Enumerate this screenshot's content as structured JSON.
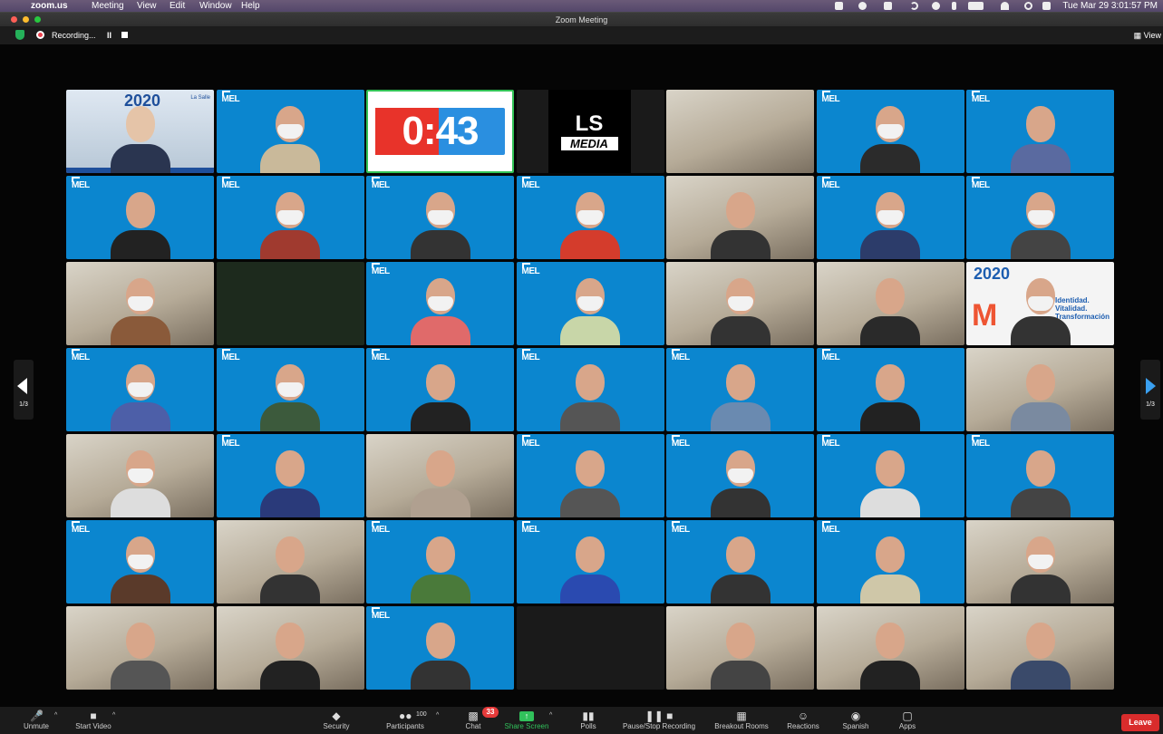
{
  "menubar": {
    "apple": "",
    "app": "zoom.us",
    "items": [
      "Meeting",
      "View",
      "Edit",
      "Window",
      "Help"
    ],
    "clock": "Tue Mar 29  3:01:57 PM",
    "tray_icons": [
      "camera-icon",
      "grammarly-icon",
      "app-icon",
      "moon-icon",
      "play-icon",
      "bluetooth-icon",
      "battery-icon",
      "wifi-icon",
      "search-icon",
      "control-center-icon"
    ]
  },
  "window": {
    "title": "Zoom Meeting"
  },
  "recording": {
    "label": "Recording...",
    "pause": "II",
    "view": "View"
  },
  "tiles": [
    {
      "kind": "first"
    },
    {
      "kind": "blue-person",
      "mask": true,
      "shirt": "#c9b99a"
    },
    {
      "kind": "timer",
      "text": "0:43"
    },
    {
      "kind": "lsmedia",
      "top": "LS",
      "bottom": "MEDIA"
    },
    {
      "kind": "room"
    },
    {
      "kind": "blue-person",
      "mask": true,
      "shirt": "#2b2b2b"
    },
    {
      "kind": "blue-person",
      "mask": false,
      "shirt": "#5a6aa0"
    },
    {
      "kind": "blue-person",
      "mask": false,
      "shirt": "#222"
    },
    {
      "kind": "blue-person",
      "mask": true,
      "shirt": "#a03a2f"
    },
    {
      "kind": "blue-person",
      "mask": true,
      "shirt": "#333"
    },
    {
      "kind": "blue-person",
      "mask": true,
      "shirt": "#d43c2c"
    },
    {
      "kind": "room-person",
      "mask": false,
      "shirt": "#333"
    },
    {
      "kind": "blue-person",
      "mask": true,
      "shirt": "#2c3c6a"
    },
    {
      "kind": "blue-person",
      "mask": true,
      "shirt": "#444"
    },
    {
      "kind": "room-person",
      "mask": true,
      "shirt": "#8a5a3a"
    },
    {
      "kind": "dark"
    },
    {
      "kind": "blue-person",
      "mask": true,
      "shirt": "#e06a6a"
    },
    {
      "kind": "blue-person",
      "mask": true,
      "shirt": "#c8d6a8"
    },
    {
      "kind": "room-person",
      "mask": true,
      "shirt": "#333"
    },
    {
      "kind": "room-person",
      "mask": false,
      "shirt": "#2a2a2a"
    },
    {
      "kind": "brand",
      "line1": "Identidad.",
      "line2": "Vitalidad.",
      "line3": "Transformación"
    },
    {
      "kind": "blue-person",
      "mask": true,
      "shirt": "#4d5fa8"
    },
    {
      "kind": "blue-person",
      "mask": true,
      "shirt": "#3c5a3c"
    },
    {
      "kind": "blue-person",
      "mask": false,
      "shirt": "#222"
    },
    {
      "kind": "blue-person",
      "mask": false,
      "shirt": "#555"
    },
    {
      "kind": "blue-person",
      "mask": false,
      "shirt": "#6a8ab0"
    },
    {
      "kind": "blue-person",
      "mask": false,
      "shirt": "#222"
    },
    {
      "kind": "room-person",
      "mask": false,
      "shirt": "#7a8aa0"
    },
    {
      "kind": "room-person",
      "mask": true,
      "shirt": "#ddd"
    },
    {
      "kind": "blue-person",
      "mask": false,
      "shirt": "#2a3a7a"
    },
    {
      "kind": "room-person",
      "mask": false,
      "shirt": "#b0a090"
    },
    {
      "kind": "blue-person",
      "mask": false,
      "shirt": "#555"
    },
    {
      "kind": "blue-person",
      "mask": true,
      "shirt": "#333"
    },
    {
      "kind": "blue-person",
      "mask": false,
      "shirt": "#ddd"
    },
    {
      "kind": "blue-person",
      "mask": false,
      "shirt": "#444"
    },
    {
      "kind": "blue-person",
      "mask": true,
      "shirt": "#5a3a2a"
    },
    {
      "kind": "room-person",
      "mask": false,
      "shirt": "#333"
    },
    {
      "kind": "blue-person",
      "mask": false,
      "shirt": "#4a7a3a"
    },
    {
      "kind": "blue-person",
      "mask": false,
      "shirt": "#2a4ab0"
    },
    {
      "kind": "blue-person",
      "mask": false,
      "shirt": "#333"
    },
    {
      "kind": "blue-person",
      "mask": false,
      "shirt": "#cfc7a8"
    },
    {
      "kind": "room-person",
      "mask": true,
      "shirt": "#333"
    },
    {
      "kind": "room-person",
      "mask": false,
      "shirt": "#555"
    },
    {
      "kind": "room-person",
      "mask": false,
      "shirt": "#222"
    },
    {
      "kind": "blue-person",
      "mask": false,
      "shirt": "#333"
    },
    {
      "kind": "empty"
    },
    {
      "kind": "room-person",
      "mask": false,
      "shirt": "#444"
    },
    {
      "kind": "room-person",
      "mask": false,
      "shirt": "#222"
    },
    {
      "kind": "room-person",
      "mask": false,
      "shirt": "#3a4a6a"
    }
  ],
  "mel_label": "MEL",
  "first_tile": {
    "logo": "2020",
    "corner": "La Salle"
  },
  "pagination": {
    "left": "1/3",
    "right": "1/3"
  },
  "toolbar": {
    "unmute": "Unmute",
    "start_video": "Start Video",
    "security": "Security",
    "participants": "Participants",
    "participants_count": "100",
    "chat": "Chat",
    "chat_badge": "33",
    "share_screen": "Share Screen",
    "polls": "Polls",
    "pause_stop_recording": "Pause/Stop Recording",
    "breakout_rooms": "Breakout Rooms",
    "reactions": "Reactions",
    "spanish": "Spanish",
    "apps": "Apps",
    "leave": "Leave"
  }
}
